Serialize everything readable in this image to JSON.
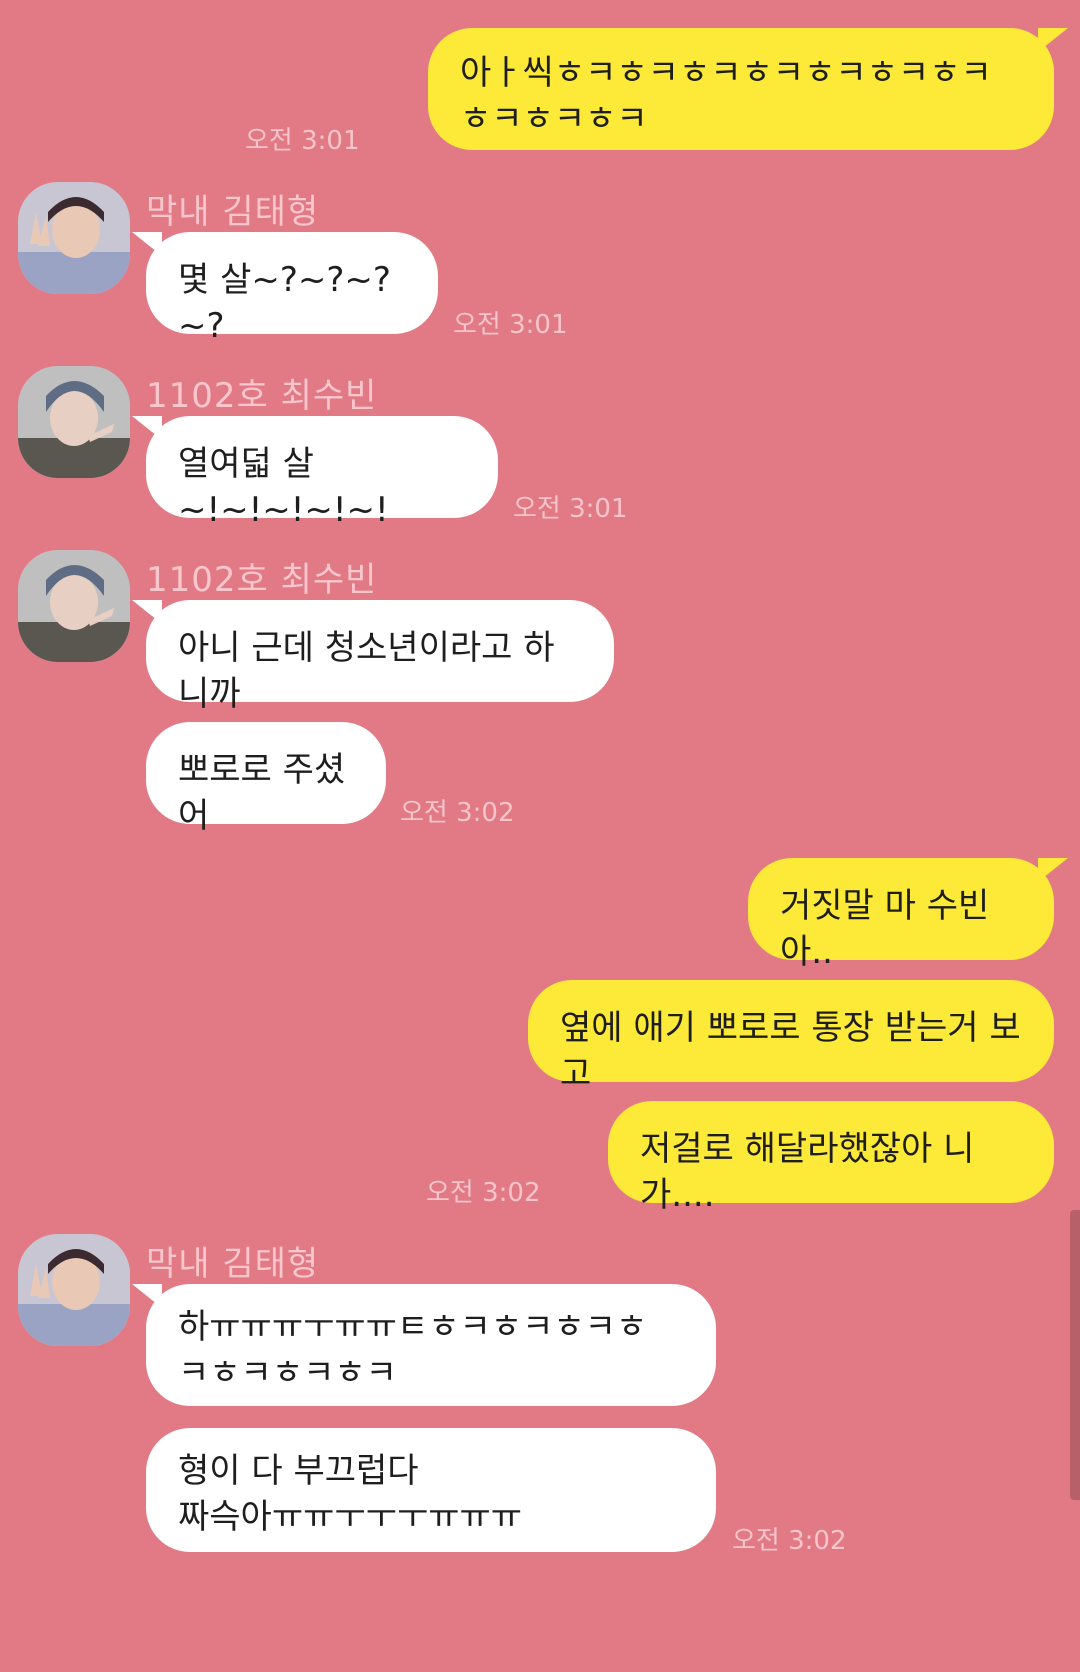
{
  "theme": {
    "background": "#e27a86",
    "incoming_bubble": "#ffffff",
    "outgoing_bubble": "#fde937",
    "meta_text": "#f6c4ca"
  },
  "messages": [
    {
      "direction": "out",
      "text": "아ㅏ씩ㅎㅋㅎㅋㅎㅋㅎㅋㅎㅋㅎㅋㅎㅋ\nㅎㅋㅎㅋㅎㅋ",
      "time": "오전 3:01"
    },
    {
      "direction": "in",
      "sender": "막내 김태형",
      "avatar_icon": "avatar-kim-taehyung",
      "text": "몇 살~?~?~?~?",
      "time": "오전 3:01"
    },
    {
      "direction": "in",
      "sender": "1102호 최수빈",
      "avatar_icon": "avatar-choi-soobin",
      "text": "열여덟 살~!~!~!~!~!",
      "time": "오전 3:01"
    },
    {
      "direction": "in",
      "sender": "1102호 최수빈",
      "avatar_icon": "avatar-choi-soobin",
      "text": "아니 근데 청소년이라고 하니까"
    },
    {
      "direction": "in",
      "text": "뽀로로 주셨어",
      "time": "오전 3:02"
    },
    {
      "direction": "out",
      "text": "거짓말 마 수빈아.."
    },
    {
      "direction": "out",
      "text": "옆에 애기 뽀로로 통장 받는거 보고"
    },
    {
      "direction": "out",
      "text": "저걸로 해달라했잖아 니가....",
      "time": "오전 3:02"
    },
    {
      "direction": "in",
      "sender": "막내 김태형",
      "avatar_icon": "avatar-kim-taehyung",
      "text": "하ㅠㅠㅠㅜㅠㅠㅌㅎㅋㅎㅋㅎㅋㅎ\nㅋㅎㅋㅎㅋㅎㅋ"
    },
    {
      "direction": "in",
      "text": "형이 다 부끄럽다\n짜슥아ㅠㅠㅜㅜㅜㅠㅠㅠ",
      "time": "오전 3:02"
    }
  ]
}
